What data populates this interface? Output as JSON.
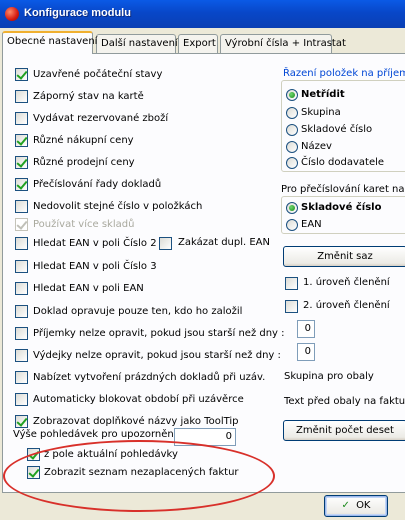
{
  "window": {
    "title": "Konfigurace modulu"
  },
  "tabs": [
    {
      "label": "Obecné nastavení"
    },
    {
      "label": "Další nastavení"
    },
    {
      "label": "Export"
    },
    {
      "label": "Výrobní čísla + Intrastat"
    }
  ],
  "options": [
    {
      "label": "Uzavřené počáteční stavy",
      "checked": true,
      "disabled": false
    },
    {
      "label": "Záporný stav na kartě",
      "checked": false,
      "disabled": false
    },
    {
      "label": "Vydávat rezervované zboží",
      "checked": false,
      "disabled": false
    },
    {
      "label": "Různé nákupní  ceny",
      "checked": true,
      "disabled": false
    },
    {
      "label": "Různé prodejní ceny",
      "checked": true,
      "disabled": false
    },
    {
      "label": "Přečíslování řady dokladů",
      "checked": true,
      "disabled": false
    },
    {
      "label": "Nedovolit stejné číslo v položkách",
      "checked": false,
      "disabled": false
    },
    {
      "label": "Používat více skladů",
      "checked": true,
      "disabled": true
    },
    {
      "label": "Hledat EAN v poli Číslo 2",
      "checked": false,
      "disabled": false
    },
    {
      "label": "Hledat EAN v poli Číslo 3",
      "checked": false,
      "disabled": false
    },
    {
      "label": "Hledat EAN v poli EAN",
      "checked": false,
      "disabled": false
    },
    {
      "label": "Doklad opravuje pouze ten, kdo ho založil",
      "checked": false,
      "disabled": false
    },
    {
      "label": "Příjemky nelze opravit, pokud jsou starší než dny :",
      "checked": false,
      "disabled": false
    },
    {
      "label": "Výdejky nelze opravit, pokud jsou starší než dny :",
      "checked": false,
      "disabled": false
    },
    {
      "label": "Nabízet vytvoření prázdných dokladů při uzáv.",
      "checked": false,
      "disabled": false
    },
    {
      "label": "Automaticky blokovat období při uzávěrce",
      "checked": false,
      "disabled": false
    },
    {
      "label": "Zobrazovat doplňkové názvy jako ToolTip",
      "checked": true,
      "disabled": false
    }
  ],
  "extra_option": {
    "label": "Zakázat dupl. EAN",
    "checked": false
  },
  "receivables": {
    "label": "Výše pohledávek pro upozornění",
    "value": "0",
    "sub_options": [
      {
        "label": "z pole aktuální pohledávky",
        "checked": true
      },
      {
        "label": "Zobrazit seznam nezaplacených faktur",
        "checked": true
      }
    ]
  },
  "sort_group": {
    "title": "Řazení položek na příjemce",
    "options": [
      {
        "label": "Netřídit",
        "selected": true
      },
      {
        "label": "Skupina",
        "selected": false
      },
      {
        "label": "Skladové číslo",
        "selected": false
      },
      {
        "label": "Název",
        "selected": false
      },
      {
        "label": "Číslo dodavatele",
        "selected": false
      }
    ]
  },
  "renumber_group": {
    "title": "Pro přečíslování karet nabíz",
    "options": [
      {
        "label": "Skladové číslo",
        "selected": true
      },
      {
        "label": "EAN",
        "selected": false
      }
    ],
    "button": "Změnit saz"
  },
  "levels": [
    {
      "label": "1. úroveň členění",
      "checked": false
    },
    {
      "label": "2. úroveň členění",
      "checked": false
    }
  ],
  "spinners": [
    "0",
    "0"
  ],
  "packaging": {
    "group_label": "Skupina pro obaly",
    "text_label": "Text před obaly na faktuře",
    "button": "Změnit počet deset"
  },
  "footer": {
    "ok_label": "OK"
  },
  "colors": {
    "titlebar": "#0a5ae6",
    "highlight_oval": "#d8302a",
    "check": "#21a121"
  }
}
